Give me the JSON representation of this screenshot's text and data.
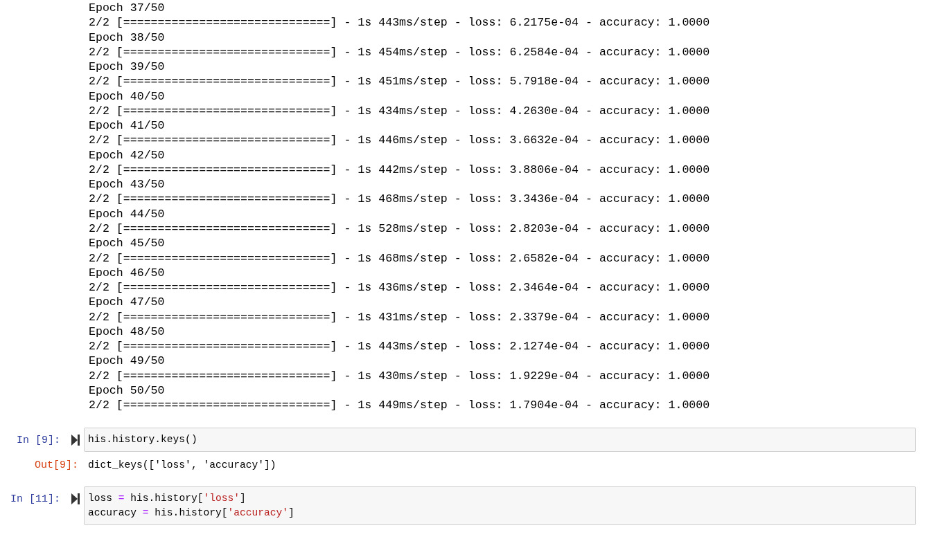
{
  "output_lines": [
    "Epoch 37/50",
    "2/2 [==============================] - 1s 443ms/step - loss: 6.2175e-04 - accuracy: 1.0000",
    "Epoch 38/50",
    "2/2 [==============================] - 1s 454ms/step - loss: 6.2584e-04 - accuracy: 1.0000",
    "Epoch 39/50",
    "2/2 [==============================] - 1s 451ms/step - loss: 5.7918e-04 - accuracy: 1.0000",
    "Epoch 40/50",
    "2/2 [==============================] - 1s 434ms/step - loss: 4.2630e-04 - accuracy: 1.0000",
    "Epoch 41/50",
    "2/2 [==============================] - 1s 446ms/step - loss: 3.6632e-04 - accuracy: 1.0000",
    "Epoch 42/50",
    "2/2 [==============================] - 1s 442ms/step - loss: 3.8806e-04 - accuracy: 1.0000",
    "Epoch 43/50",
    "2/2 [==============================] - 1s 468ms/step - loss: 3.3436e-04 - accuracy: 1.0000",
    "Epoch 44/50",
    "2/2 [==============================] - 1s 528ms/step - loss: 2.8203e-04 - accuracy: 1.0000",
    "Epoch 45/50",
    "2/2 [==============================] - 1s 468ms/step - loss: 2.6582e-04 - accuracy: 1.0000",
    "Epoch 46/50",
    "2/2 [==============================] - 1s 436ms/step - loss: 2.3464e-04 - accuracy: 1.0000",
    "Epoch 47/50",
    "2/2 [==============================] - 1s 431ms/step - loss: 2.3379e-04 - accuracy: 1.0000",
    "Epoch 48/50",
    "2/2 [==============================] - 1s 443ms/step - loss: 2.1274e-04 - accuracy: 1.0000",
    "Epoch 49/50",
    "2/2 [==============================] - 1s 430ms/step - loss: 1.9229e-04 - accuracy: 1.0000",
    "Epoch 50/50",
    "2/2 [==============================] - 1s 449ms/step - loss: 1.7904e-04 - accuracy: 1.0000"
  ],
  "cells": [
    {
      "prompt": "In [9]:",
      "code": [
        [
          {
            "kind": "plain",
            "text": "his.history.keys()"
          }
        ]
      ],
      "out_prompt": "Out[9]:",
      "output": "dict_keys(['loss', 'accuracy'])"
    },
    {
      "prompt": "In [11]:",
      "code": [
        [
          {
            "kind": "plain",
            "text": "loss "
          },
          {
            "kind": "operator",
            "text": "="
          },
          {
            "kind": "plain",
            "text": " his.history["
          },
          {
            "kind": "string",
            "text": "'loss'"
          },
          {
            "kind": "plain",
            "text": "]"
          }
        ],
        [
          {
            "kind": "plain",
            "text": "accuracy "
          },
          {
            "kind": "operator",
            "text": "="
          },
          {
            "kind": "plain",
            "text": " his.history["
          },
          {
            "kind": "string",
            "text": "'accuracy'"
          },
          {
            "kind": "plain",
            "text": "]"
          }
        ]
      ]
    }
  ]
}
